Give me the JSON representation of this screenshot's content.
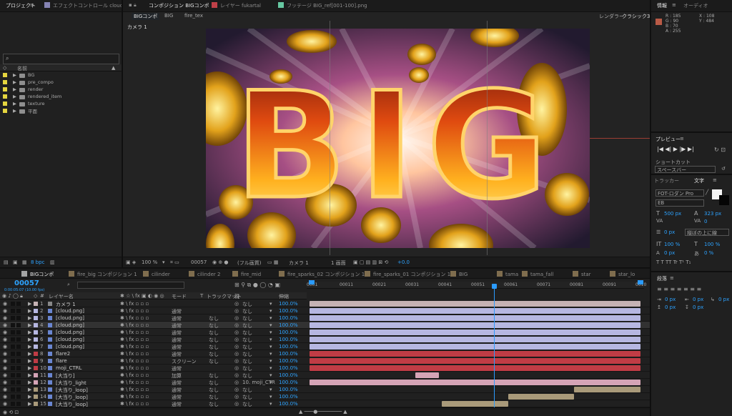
{
  "project": {
    "tabs": [
      "プロジェクト",
      "エフェクトコントロール cloud.p"
    ],
    "search_icon": "search-icon",
    "col_header": "名前",
    "items": [
      "BG",
      "pre_compo",
      "render",
      "rendered_item",
      "texture",
      "平面"
    ],
    "bpc": "8 bpc"
  },
  "comp_header": {
    "tabs": [
      "コンポジション BIGコンポ",
      "レイヤー fukartal",
      "フッテージ BIG_ref[001-100].png"
    ],
    "breadcrumbs": [
      "BIGコンポ",
      "BIG",
      "fire_tex"
    ],
    "renderer_label": "レンダラー",
    "renderer_value": "クラシック3D",
    "camera_label": "カメラ 1"
  },
  "viewer": {
    "headline": "BIG",
    "zoom": "100 %",
    "frame": "00057",
    "resolution": "(フル画質)",
    "camera": "カメラ 1",
    "views": "1 画面",
    "exposure": "+0.0"
  },
  "info": {
    "tabs": [
      "情報",
      "オーディオ"
    ],
    "r": "R : 185",
    "g": "G : 90",
    "b": "B : 70",
    "a": "A : 255",
    "x": "X : 108",
    "y": "Y : 484"
  },
  "preview": {
    "title": "プレビュー",
    "shortcut_label": "ショートカット",
    "shortcut_value": "スペースバー"
  },
  "character": {
    "tabs": [
      "トラッカー",
      "文字"
    ],
    "font": "FOT-ロダン Pro",
    "weight": "EB",
    "size": "500 px",
    "leading": "323 px",
    "tracking": "0",
    "scale_v": "100 %",
    "scale_h": "100 %",
    "baseline": "0 px",
    "tsume": "0 %",
    "line_mode": "縦ぼの上に線"
  },
  "paragraph": {
    "title": "段落",
    "vals": [
      "0 px",
      "0 px",
      "0 px",
      "0 px",
      "0 px"
    ]
  },
  "timeline": {
    "tabs": [
      "BIGコンポ",
      "fire_big コンポジション 1",
      "cilinder",
      "cilinder 2",
      "fire_mid",
      "fire_sparks_02 コンポジション 1",
      "fire_sparks_01 コンポジション 1",
      "BIG",
      "tama",
      "tama_fall",
      "star",
      "star_lo"
    ],
    "timecode": "00057",
    "timecode_sub": "0:00:05:07 (10.00 fps)",
    "header": {
      "name": "レイヤー名",
      "mode": "モード",
      "t": "T",
      "track": "トラックマット",
      "parent": "親",
      "stretch": "伸縮"
    },
    "ticks": [
      "0001",
      "00011",
      "00021",
      "00031",
      "00041",
      "00051",
      "00061",
      "00071",
      "00081",
      "00091",
      "0010"
    ]
  },
  "layers": [
    {
      "n": "1",
      "name": "カメラ 1",
      "mode": "",
      "track": "",
      "parent": "なし",
      "stretch": "100.0%",
      "color": "#c5b2b4",
      "bar": [
        0,
        1
      ]
    },
    {
      "n": "2",
      "name": "[cloud.png]",
      "mode": "通常",
      "track": "",
      "parent": "なし",
      "stretch": "100.0%",
      "color": "#b6b7e1",
      "bar": [
        0,
        1
      ]
    },
    {
      "n": "3",
      "name": "[cloud.png]",
      "mode": "通常",
      "track": "なし",
      "parent": "なし",
      "stretch": "100.0%",
      "color": "#b6b7e1",
      "bar": [
        0,
        1
      ]
    },
    {
      "n": "4",
      "name": "[cloud.png]",
      "mode": "通常",
      "track": "なし",
      "parent": "なし",
      "stretch": "100.0%",
      "color": "#b6b7e1",
      "bar": [
        0,
        1
      ]
    },
    {
      "n": "5",
      "name": "[cloud.png]",
      "mode": "通常",
      "track": "なし",
      "parent": "なし",
      "stretch": "100.0%",
      "color": "#b6b7e1",
      "bar": [
        0,
        1
      ]
    },
    {
      "n": "6",
      "name": "[cloud.png]",
      "mode": "通常",
      "track": "なし",
      "parent": "なし",
      "stretch": "100.0%",
      "color": "#b6b7e1",
      "bar": [
        0,
        1
      ]
    },
    {
      "n": "7",
      "name": "[cloud.png]",
      "mode": "通常",
      "track": "なし",
      "parent": "なし",
      "stretch": "100.0%",
      "color": "#b6b7e1",
      "bar": [
        0,
        1
      ]
    },
    {
      "n": "8",
      "name": "flare2",
      "mode": "通常",
      "track": "なし",
      "parent": "なし",
      "stretch": "100.0%",
      "color": "#c03c45",
      "bar": [
        0,
        1
      ]
    },
    {
      "n": "9",
      "name": "flare",
      "mode": "スクリーン",
      "track": "なし",
      "parent": "なし",
      "stretch": "100.0%",
      "color": "#c03c45",
      "bar": [
        0,
        1
      ]
    },
    {
      "n": "10",
      "name": "moji_CTRL",
      "mode": "通常",
      "track": "",
      "parent": "なし",
      "stretch": "100.0%",
      "color": "#c03c45",
      "bar": [
        0,
        1
      ]
    },
    {
      "n": "11",
      "name": "[大当り]",
      "mode": "加算",
      "track": "なし",
      "parent": "なし",
      "stretch": "100.0%",
      "color": "#d5a4b6",
      "bar": [
        0.32,
        0.39
      ]
    },
    {
      "n": "12",
      "name": "[大当り_light",
      "mode": "通常",
      "track": "なし",
      "parent": "10. moji_CTR",
      "stretch": "100.0%",
      "color": "#d5a4b6",
      "bar": [
        0,
        1
      ]
    },
    {
      "n": "13",
      "name": "[大当り_loop]",
      "mode": "通常",
      "track": "なし",
      "parent": "なし",
      "stretch": "100.0%",
      "color": "#a99a7a",
      "bar": [
        0.8,
        1
      ]
    },
    {
      "n": "14",
      "name": "[大当り_loop]",
      "mode": "通常",
      "track": "なし",
      "parent": "なし",
      "stretch": "100.0%",
      "color": "#a99a7a",
      "bar": [
        0.6,
        0.8
      ]
    },
    {
      "n": "15",
      "name": "[大当り_loop]",
      "mode": "通常",
      "track": "なし",
      "parent": "なし",
      "stretch": "100.0%",
      "color": "#a99a7a",
      "bar": [
        0.4,
        0.6
      ]
    }
  ],
  "colors": {
    "accent": "#2d8cff",
    "bg": "#232323",
    "panel": "#1b1b1b",
    "playhead": "#2b9bff"
  }
}
